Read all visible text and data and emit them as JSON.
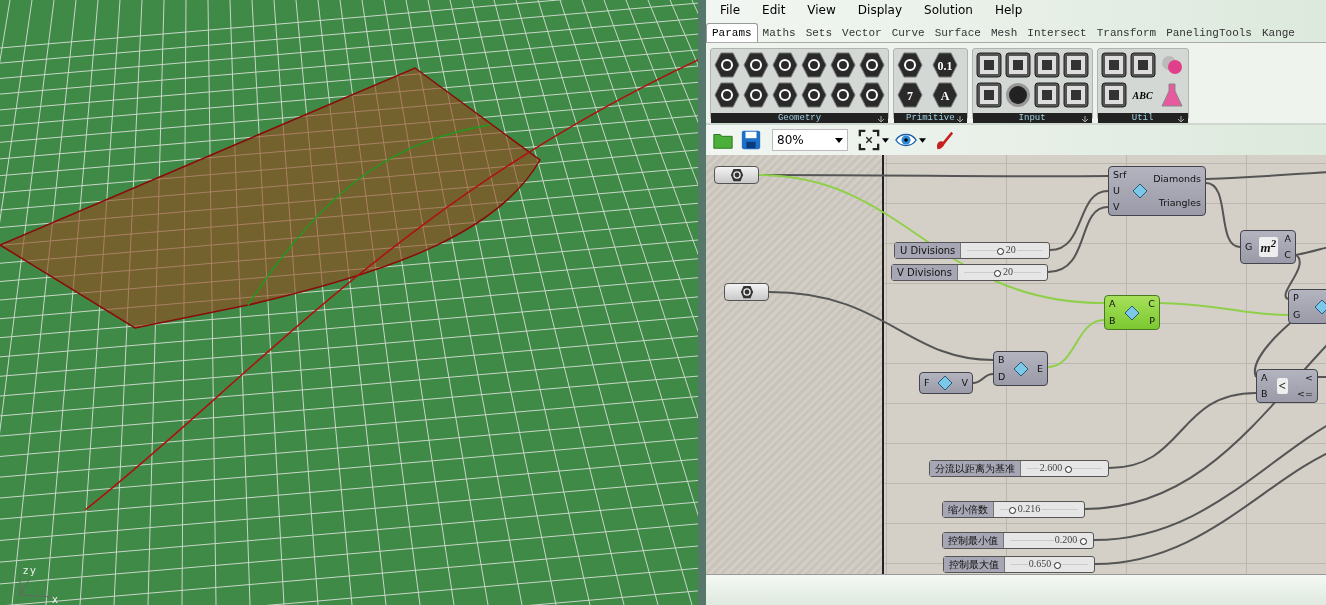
{
  "viewport": {
    "axis_labels": [
      "z",
      "y",
      "x"
    ]
  },
  "menu": [
    "File",
    "Edit",
    "View",
    "Display",
    "Solution",
    "Help"
  ],
  "tabs": [
    {
      "label": "Params",
      "selected": true
    },
    {
      "label": "Maths",
      "selected": false
    },
    {
      "label": "Sets",
      "selected": false
    },
    {
      "label": "Vector",
      "selected": false
    },
    {
      "label": "Curve",
      "selected": false
    },
    {
      "label": "Surface",
      "selected": false
    },
    {
      "label": "Mesh",
      "selected": false
    },
    {
      "label": "Intersect",
      "selected": false
    },
    {
      "label": "Transform",
      "selected": false
    },
    {
      "label": "PanelingTools",
      "selected": false
    },
    {
      "label": "Kange",
      "selected": false
    }
  ],
  "ribbon": [
    {
      "label": "Geometry",
      "buttons": [
        {
          "kind": "hex"
        },
        {
          "kind": "hex"
        },
        {
          "kind": "hex"
        },
        {
          "kind": "hex"
        },
        {
          "kind": "hex"
        },
        {
          "kind": "hex"
        },
        {
          "kind": "hex"
        },
        {
          "kind": "hex"
        },
        {
          "kind": "hex"
        },
        {
          "kind": "hex"
        },
        {
          "kind": "hex"
        },
        {
          "kind": "hex"
        }
      ]
    },
    {
      "label": "Primitive",
      "buttons": [
        {
          "kind": "hex"
        },
        {
          "kind": "hex",
          "glyph": "7"
        },
        {
          "kind": "hex",
          "glyph": "0.1"
        },
        {
          "kind": "hex",
          "glyph": "A"
        }
      ]
    },
    {
      "label": "Input",
      "buttons": [
        {
          "kind": "tile"
        },
        {
          "kind": "tile"
        },
        {
          "kind": "tile"
        },
        {
          "kind": "knob"
        },
        {
          "kind": "tile"
        },
        {
          "kind": "tile"
        },
        {
          "kind": "tile"
        },
        {
          "kind": "tile"
        }
      ]
    },
    {
      "label": "Util",
      "buttons": [
        {
          "kind": "tile"
        },
        {
          "kind": "tile"
        },
        {
          "kind": "tile"
        },
        {
          "kind": "text",
          "glyph": "ABC"
        },
        {
          "kind": "balls"
        },
        {
          "kind": "flask"
        }
      ]
    }
  ],
  "toolbar": {
    "zoom": "80%"
  },
  "canvas": {
    "nodes": [
      {
        "kind": "param"
      },
      {
        "kind": "param"
      },
      {
        "kind": "component",
        "inputs": [
          "Srf",
          "U",
          "V"
        ],
        "outputs": [
          "Diamonds",
          "Triangles"
        ],
        "selected": false
      },
      {
        "kind": "slider",
        "label": "U Divisions",
        "value": "20",
        "level": 0.43
      },
      {
        "kind": "slider",
        "label": "V Divisions",
        "value": "20",
        "level": 0.43
      },
      {
        "kind": "component",
        "inputs": [
          "G"
        ],
        "outputs": [
          "A",
          "C"
        ],
        "icon_label": "m$^{2}$",
        "selected": false
      },
      {
        "kind": "component",
        "inputs": [
          "A",
          "B"
        ],
        "outputs": [
          "C",
          "P"
        ],
        "selected": true
      },
      {
        "kind": "component",
        "inputs": [
          "P",
          "G"
        ],
        "selected": false
      },
      {
        "kind": "component",
        "inputs": [
          "B",
          "D"
        ],
        "outputs": [
          "E"
        ],
        "selected": false
      },
      {
        "kind": "component",
        "inputs": [
          "F"
        ],
        "outputs": [
          "V"
        ],
        "selected": false
      },
      {
        "kind": "component",
        "inputs": [
          "A",
          "B"
        ],
        "outputs": [
          "<",
          "<="
        ],
        "icon_label": "<",
        "selected": false
      },
      {
        "kind": "slider",
        "label": "分流以距离为基准",
        "value": "2.600",
        "level": 0.55
      },
      {
        "kind": "slider",
        "label": "缩小倍数",
        "value": "0.216",
        "level": 0.15
      },
      {
        "kind": "slider",
        "label": "控制最小值",
        "value": "0.200",
        "level": 0.95
      },
      {
        "kind": "slider",
        "label": "控制最大值",
        "value": "0.650",
        "level": 0.6
      }
    ]
  }
}
